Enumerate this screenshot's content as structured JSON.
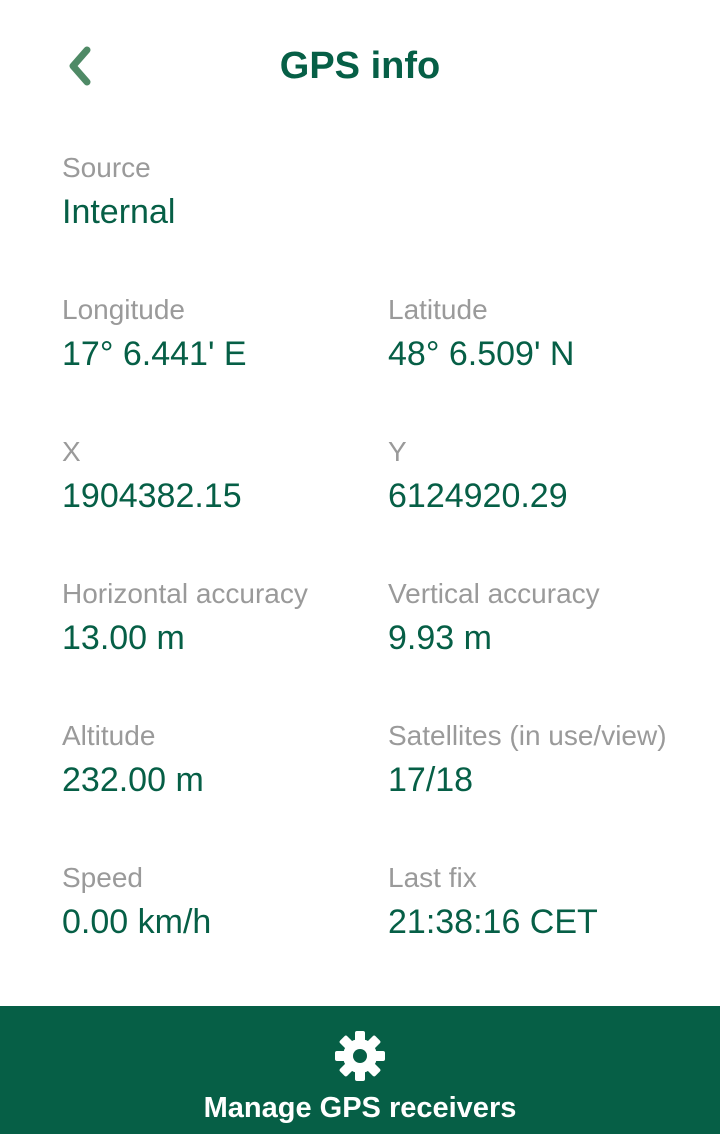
{
  "header": {
    "title": "GPS info",
    "back_icon": "chevron-left-icon"
  },
  "colors": {
    "accent": "#065f46",
    "label": "#9a9a9a",
    "background": "#ffffff"
  },
  "fields": {
    "source": {
      "label": "Source",
      "value": "Internal"
    },
    "longitude": {
      "label": "Longitude",
      "value": "17° 6.441' E"
    },
    "latitude": {
      "label": "Latitude",
      "value": "48° 6.509' N"
    },
    "x": {
      "label": "X",
      "value": "1904382.15"
    },
    "y": {
      "label": "Y",
      "value": "6124920.29"
    },
    "horizontal_accuracy": {
      "label": "Horizontal accuracy",
      "value": "13.00 m"
    },
    "vertical_accuracy": {
      "label": "Vertical accuracy",
      "value": "9.93 m"
    },
    "altitude": {
      "label": "Altitude",
      "value": "232.00 m"
    },
    "satellites": {
      "label": "Satellites (in use/view)",
      "value": "17/18"
    },
    "speed": {
      "label": "Speed",
      "value": "0.00 km/h"
    },
    "last_fix": {
      "label": "Last fix",
      "value": "21:38:16 CET"
    }
  },
  "bottom_bar": {
    "label": "Manage GPS receivers",
    "icon": "gear-icon"
  }
}
